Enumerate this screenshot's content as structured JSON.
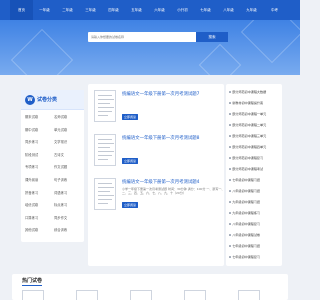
{
  "nav": {
    "items": [
      "首页",
      "一年级",
      "二年级",
      "三年级",
      "四年级",
      "五年级",
      "六年级",
      "小升初",
      "七年级",
      "八年级",
      "九年级",
      "中考"
    ]
  },
  "search": {
    "placeholder": "请输入你想要的试卷名称",
    "button": "搜索"
  },
  "category": {
    "title": "试卷分类",
    "icon": "W",
    "items": [
      "期末试卷",
      "名师试卷",
      "期中试卷",
      "单元试卷",
      "同步练习",
      "文学常识",
      "阶段测试",
      "古诗文",
      "专项练习",
      "作文试题",
      "课外阅读",
      "句子训练",
      "拼音练习",
      "词语练习",
      "培优试卷",
      "标点练习",
      "口算练习",
      "同步作文",
      "其他试卷",
      "综合训练"
    ]
  },
  "papers": [
    {
      "title": "统编语文一年级下册第一次月考测试题7",
      "desc": "",
      "button": "立即阅读"
    },
    {
      "title": "统编语文一年级下册第一次月考测试题8",
      "desc": "",
      "button": "立即阅读"
    },
    {
      "title": "统编语文一年级下册第一次月考测试题4",
      "desc": "小学一年级下册第一次月考测试题 时间：30分钟 满分：100分 一、默写一、二、三、四、五、六、七、八、九、十（20分）",
      "button": "立即阅读"
    }
  ],
  "recent": [
    "部分师范初中课程大数据",
    "新教材初中课程提升案",
    "部分师范初中课程一单元",
    "部分师范初中课程二单元",
    "部分师范初中课程三单元",
    "部分师范初中课程四单元",
    "部分师范初中课程复习",
    "部分师范初中课程考试",
    "七年级初中课程习题",
    "八年级初中课程习题",
    "九年级初中课程习题",
    "九年级初中课程练习",
    "八年级初中课程复习",
    "八年级初中课程试卷",
    "七年级初中课程习题",
    "七年级初中课程复习"
  ],
  "hot": {
    "title": "热门试卷"
  },
  "colors": {
    "brand": "#1f5ec8",
    "hero_top": "#3f82e4",
    "hero_bottom": "#79abef",
    "background": "#eef1f6"
  }
}
